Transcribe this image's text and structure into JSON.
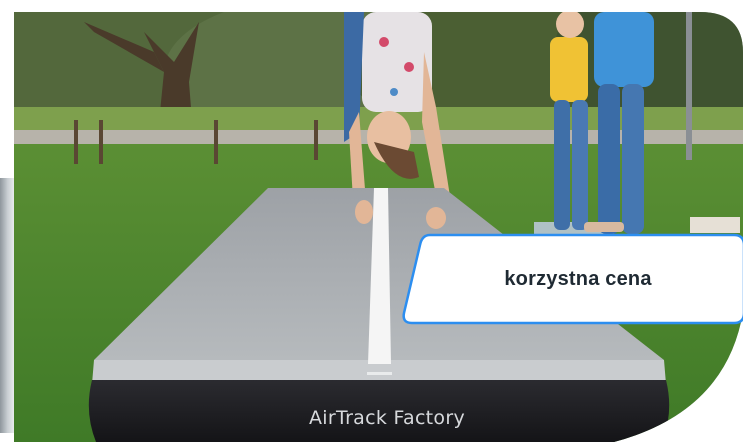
{
  "badge": {
    "label": "korzystna cena"
  },
  "product": {
    "brand_print": "AirTrack Factory"
  },
  "colors": {
    "badge_border": "#2c8ef0",
    "badge_fill": "#ffffff",
    "badge_text": "#1f2a33",
    "mat_top": "#a9adb1",
    "mat_base": "#1d1d21",
    "mat_stripe": "#f5f5f5",
    "grass": "#4f8a2f"
  }
}
